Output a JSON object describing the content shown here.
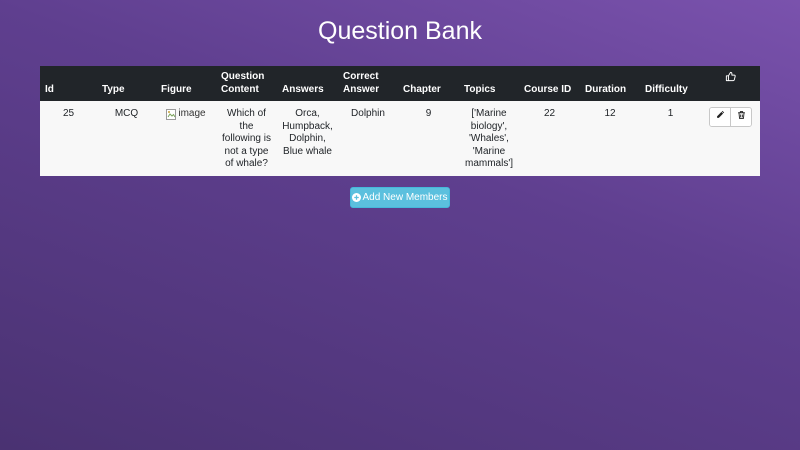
{
  "page": {
    "title": "Question Bank"
  },
  "table": {
    "headers": {
      "id": "Id",
      "type": "Type",
      "figure": "Figure",
      "question_content": "Question Content",
      "answers": "Answers",
      "correct_answer": "Correct Answer",
      "chapter": "Chapter",
      "topics": "Topics",
      "course_id": "Course ID",
      "duration": "Duration",
      "difficulty": "Difficulty",
      "actions_icon": "thumbs-up-icon"
    },
    "rows": [
      {
        "id": "25",
        "type": "MCQ",
        "figure_alt": "image",
        "question_content": "Which of the following is not a type of whale?",
        "answers": "Orca, Humpback, Dolphin, Blue whale",
        "correct_answer": "Dolphin",
        "chapter": "9",
        "topics": "['Marine biology', 'Whales', 'Marine mammals']",
        "course_id": "22",
        "duration": "12",
        "difficulty": "1",
        "edit_icon": "pencil-icon",
        "delete_icon": "trash-icon"
      }
    ]
  },
  "add_button": {
    "label": "Add New Members",
    "icon": "plus-circle-icon"
  },
  "colors": {
    "header_bg": "#212529",
    "row_bg": "#f8f8f8",
    "button_bg": "#5bc0de",
    "background_top": "#7a52ad",
    "background_bottom": "#4a3272"
  }
}
